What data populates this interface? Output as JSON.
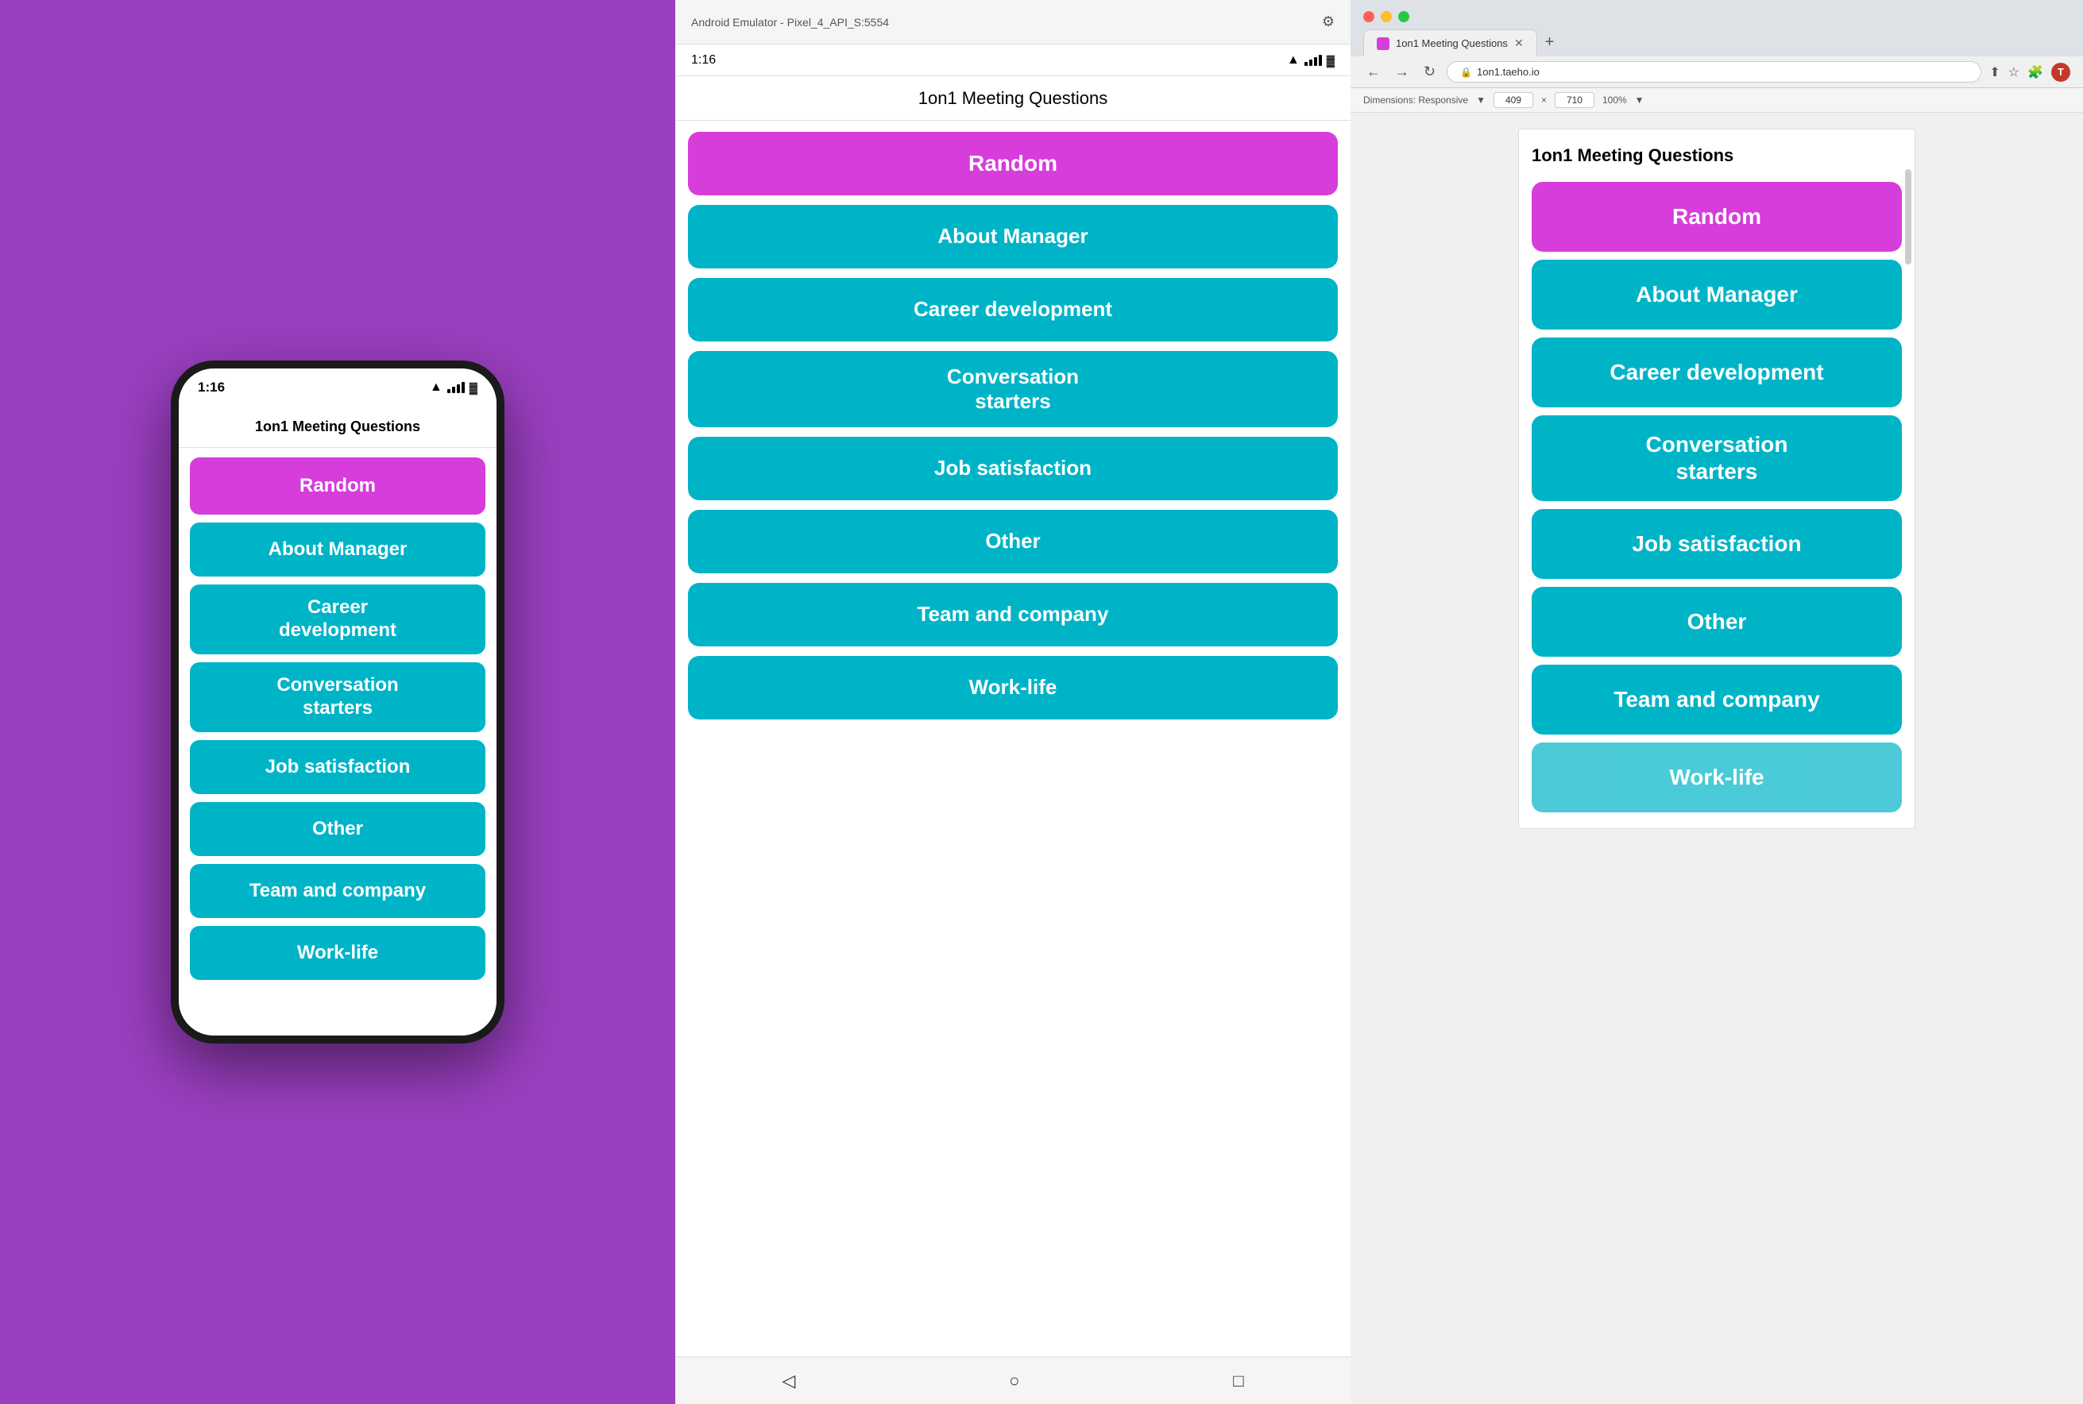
{
  "app": {
    "title": "1on1 Meeting Questions"
  },
  "ios": {
    "time": "1:16",
    "nav_title": "1on1 Meeting Questions"
  },
  "android": {
    "window_title": "Android Emulator - Pixel_4_API_S:5554",
    "time": "1:16",
    "nav_title": "1on1 Meeting Questions"
  },
  "browser": {
    "tab_title": "1on1 Meeting Questions",
    "url": "1on1.taeho.io",
    "dimensions_label": "Dimensions: Responsive",
    "width": "409",
    "height_val": "710",
    "zoom": "100%",
    "page_title": "1on1 Meeting Questions",
    "scrollbar_visible": true
  },
  "menu_items": [
    {
      "id": "random",
      "label": "Random",
      "type": "random"
    },
    {
      "id": "about-manager",
      "label": "About Manager",
      "type": "teal"
    },
    {
      "id": "career-development",
      "label": "Career development",
      "type": "teal"
    },
    {
      "id": "conversation-starters",
      "label": "Conversation starters",
      "type": "teal-tall"
    },
    {
      "id": "job-satisfaction",
      "label": "Job satisfaction",
      "type": "teal"
    },
    {
      "id": "other",
      "label": "Other",
      "type": "teal"
    },
    {
      "id": "team-and-company",
      "label": "Team and company",
      "type": "teal"
    },
    {
      "id": "work-life",
      "label": "Work-life",
      "type": "teal"
    }
  ],
  "colors": {
    "random": "#d63ddb",
    "teal": "#00b4c8",
    "background": "#9b3fc1"
  }
}
